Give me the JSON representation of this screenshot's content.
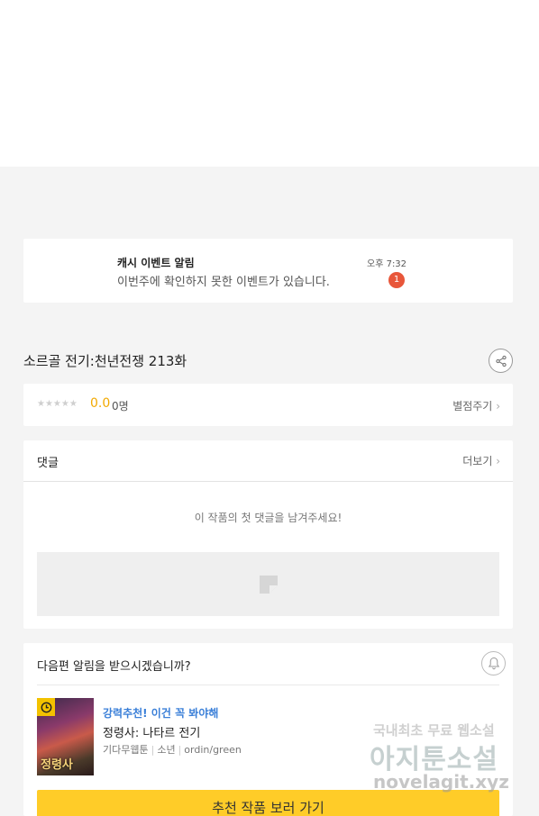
{
  "notification": {
    "title": "캐시 이벤트 알림",
    "message": "이번주에 확인하지 못한 이벤트가 있습니다.",
    "time": "오후 7:32",
    "badge_count": "1"
  },
  "episode": {
    "title": "소르골 전기:천년전쟁 213화"
  },
  "rating": {
    "stars": "★★★★★",
    "score": "0.0",
    "count": "0명",
    "rate_link": "별점주기"
  },
  "comments": {
    "heading": "댓글",
    "more": "더보기",
    "empty_message": "이 작품의 첫 댓글을 남겨주세요!"
  },
  "next_alarm": {
    "question": "다음편 알림을 받으시겠습니까?"
  },
  "recommendation": {
    "label": "강력추천! 이건 꼭 봐야해",
    "title": "정령사: 나타르 전기",
    "genre": "기다무웹툰",
    "category": "소년",
    "author": "ordin/green",
    "cover_text": "정령사",
    "button": "추천 작품 보러 가기"
  },
  "watermark": {
    "line1": "국내최초 무료 웹소설",
    "line2": "아지툰소설",
    "line3": "novelagit.xyz"
  },
  "colors": {
    "accent_yellow": "#ffcc28",
    "score_orange": "#f2a900",
    "badge_red": "#e8563a",
    "link_blue": "#3a7fd8"
  }
}
